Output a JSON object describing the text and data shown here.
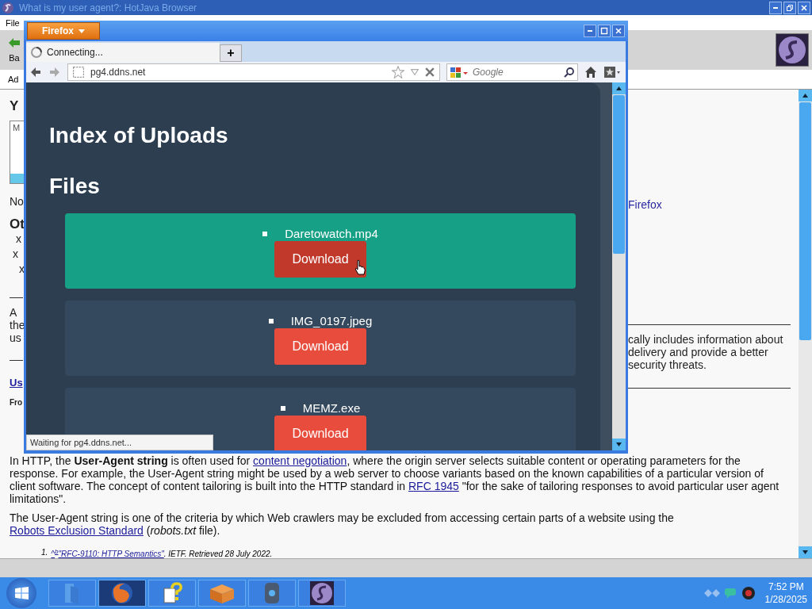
{
  "background_window": {
    "title": "What is my user agent?: HotJava Browser",
    "menu": [
      "File"
    ],
    "toolbar_label": "Ba",
    "address_label": "Ad",
    "left_fragments": [
      {
        "kind": "heading",
        "text": "Y"
      },
      {
        "kind": "box",
        "text": "M"
      },
      {
        "kind": "text",
        "text": "No"
      },
      {
        "kind": "heading",
        "text": "Ot"
      },
      {
        "kind": "item",
        "text": "x"
      },
      {
        "kind": "item",
        "text": "x"
      },
      {
        "kind": "item",
        "text": "x"
      },
      {
        "kind": "rule"
      },
      {
        "kind": "para",
        "text": "A"
      },
      {
        "kind": "para",
        "text": "the"
      },
      {
        "kind": "para",
        "text": "us"
      },
      {
        "kind": "rule"
      },
      {
        "kind": "section",
        "text": "Us"
      },
      {
        "kind": "small",
        "text": "Fro"
      }
    ],
    "right_fragments": [
      {
        "kind": "link",
        "text": "Firefox"
      },
      {
        "kind": "rule"
      },
      {
        "kind": "para",
        "text": "cally includes information about"
      },
      {
        "kind": "para",
        "text": "delivery and provide a better"
      },
      {
        "kind": "para",
        "text": "security threats."
      },
      {
        "kind": "rule"
      }
    ],
    "paragraphs": [
      [
        {
          "kind": "text",
          "text": "In HTTP, the "
        },
        {
          "kind": "bold",
          "text": "User-Agent string"
        },
        {
          "kind": "text",
          "text": " is often used for "
        },
        {
          "kind": "link",
          "text": "content negotiation"
        },
        {
          "kind": "text",
          "text": ", where the origin server selects suitable content or operating parameters for the response. For example, the User-Agent string might be used by a web server to choose variants based on the known capabilities of a particular version of client software. The concept of content tailoring is built into the HTTP standard in "
        },
        {
          "kind": "link",
          "text": "RFC 1945"
        },
        {
          "kind": "text",
          "text": " \"for the sake of tailoring responses to avoid particular user agent limitations\"."
        }
      ],
      [
        {
          "kind": "text",
          "text": "The User-Agent string is one of the criteria by which Web crawlers may be excluded from accessing certain parts of a website using the "
        },
        {
          "kind": "link",
          "text": "Robots Exclusion Standard"
        },
        {
          "kind": "text",
          "text": " ("
        },
        {
          "kind": "italic",
          "text": "robots.txt"
        },
        {
          "kind": "text",
          "text": " file)."
        }
      ]
    ],
    "footnote": {
      "number": "1.",
      "parts": [
        {
          "kind": "link",
          "text": "^"
        },
        {
          "kind": "suplink",
          "text": "b"
        },
        {
          "kind": "link",
          "text": "\"RFC-9110: HTTP Semantics\""
        },
        {
          "kind": "text",
          "text": ". IETF. Retrieved 28 July 2022."
        }
      ]
    }
  },
  "firefox": {
    "menu_button": "Firefox",
    "tabs": [
      {
        "label": "Connecting...",
        "selected": true
      }
    ],
    "new_tab": "+",
    "url": "pg4.ddns.net",
    "search_placeholder": "Google",
    "status": "Waiting for pg4.ddns.net...",
    "page": {
      "title": "Index of Uploads",
      "subtitle": "Files",
      "files": [
        {
          "name": "Daretowatch.mp4",
          "button": "Download",
          "hovered": true
        },
        {
          "name": "IMG_0197.jpeg",
          "button": "Download",
          "hovered": false
        },
        {
          "name": "MEMZ.exe",
          "button": "Download",
          "hovered": false
        }
      ]
    }
  },
  "taskbar": {
    "apps": [
      {
        "kind": "folder",
        "selected": false
      },
      {
        "kind": "firefox",
        "selected": true
      },
      {
        "kind": "help",
        "selected": false
      },
      {
        "kind": "box",
        "selected": false
      },
      {
        "kind": "disc",
        "selected": false
      },
      {
        "kind": "logo",
        "selected": false
      }
    ],
    "time": "7:52 PM",
    "date": "1/28/2025"
  }
}
